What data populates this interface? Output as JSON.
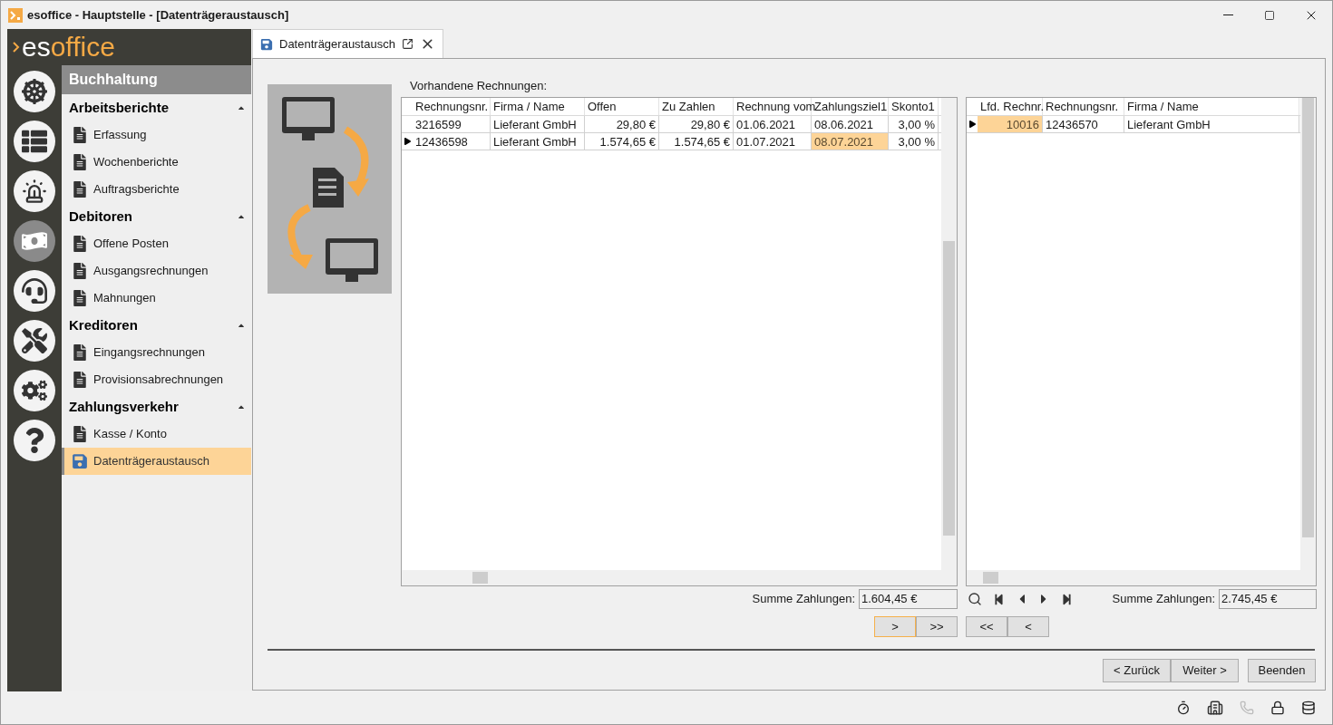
{
  "window": {
    "title": "esoffice - Hauptstelle - [Datenträgeraustausch]"
  },
  "logo": {
    "part_1": "es",
    "part_2": "office"
  },
  "rail": [
    {
      "selected": false
    },
    {
      "selected": false
    },
    {
      "selected": false
    },
    {
      "selected": true
    },
    {
      "selected": false
    },
    {
      "selected": false
    },
    {
      "selected": false
    },
    {
      "selected": false
    }
  ],
  "nav": {
    "title": "Buchhaltung",
    "sections": [
      {
        "title": "Arbeitsberichte",
        "expanded": true,
        "items": [
          {
            "label": "Erfassung",
            "selected": false
          },
          {
            "label": "Wochenberichte",
            "selected": false
          },
          {
            "label": "Auftragsberichte",
            "selected": false
          }
        ]
      },
      {
        "title": "Debitoren",
        "expanded": true,
        "items": [
          {
            "label": "Offene Posten",
            "selected": false
          },
          {
            "label": "Ausgangsrechnungen",
            "selected": false
          },
          {
            "label": "Mahnungen",
            "selected": false
          }
        ]
      },
      {
        "title": "Kreditoren",
        "expanded": true,
        "items": [
          {
            "label": "Eingangsrechnungen",
            "selected": false
          },
          {
            "label": "Provisionsabrechnungen",
            "selected": false
          }
        ]
      },
      {
        "title": "Zahlungsverkehr",
        "expanded": true,
        "items": [
          {
            "label": "Kasse / Konto",
            "selected": false
          },
          {
            "label": "Datenträgeraustausch",
            "selected": true
          }
        ]
      }
    ]
  },
  "tab": {
    "label": "Datenträgeraustausch"
  },
  "list_label": "Vorhandene Rechnungen:",
  "invoices": {
    "columns": [
      {
        "label": "Rechnungsnr.",
        "right_aligned": false
      },
      {
        "label": "Firma / Name",
        "right_aligned": false
      },
      {
        "label": "Offen",
        "right_aligned": true
      },
      {
        "label": "Zu Zahlen",
        "right_aligned": true
      },
      {
        "label": "Rechnung vom",
        "right_aligned": false
      },
      {
        "label": "Zahlungsziel1",
        "right_aligned": false
      },
      {
        "label": "Skonto1",
        "right_aligned": true
      }
    ],
    "rows": [
      {
        "current": false,
        "cells": [
          "3216599",
          "Lieferant GmbH",
          "29,80 €",
          "29,80 €",
          "01.06.2021",
          "08.06.2021",
          "3,00 %"
        ],
        "focused": [
          false,
          false,
          false,
          false,
          false,
          false,
          false
        ]
      },
      {
        "current": true,
        "cells": [
          "12436598",
          "Lieferant GmbH",
          "1.574,65 €",
          "1.574,65 €",
          "01.07.2021",
          "08.07.2021",
          "3,00 %"
        ],
        "focused": [
          false,
          false,
          false,
          false,
          false,
          true,
          false
        ]
      }
    ],
    "sum": {
      "label": "Summe Zahlungen:",
      "value": "1.604,45 €"
    },
    "buttons": [
      {
        "label": ">",
        "focused": true
      },
      {
        "label": ">>",
        "focused": false
      }
    ]
  },
  "payments": {
    "columns": [
      {
        "label": "Lfd. Rechnr.",
        "right_aligned": true
      },
      {
        "label": "Rechnungsnr.",
        "right_aligned": false
      },
      {
        "label": "Firma / Name",
        "right_aligned": false
      }
    ],
    "rows": [
      {
        "current": true,
        "cells": [
          "10016",
          "12436570",
          "Lieferant GmbH"
        ],
        "focused": [
          true,
          false,
          false
        ]
      }
    ],
    "sum": {
      "label": "Summe Zahlungen:",
      "value": "2.745,45 €"
    },
    "buttons": [
      {
        "label": "<<",
        "focused": false
      },
      {
        "label": "<",
        "focused": false
      }
    ]
  },
  "footer_buttons": [
    "< Zurück",
    "Weiter >",
    "Beenden"
  ]
}
